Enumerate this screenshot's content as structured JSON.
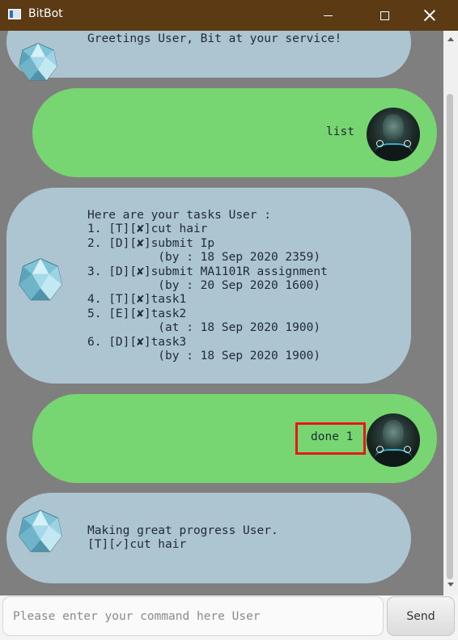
{
  "window": {
    "title": "BitBot"
  },
  "messages": [
    {
      "sender": "bot",
      "text": "Greetings User, Bit at your service!"
    },
    {
      "sender": "user",
      "text": "list"
    },
    {
      "sender": "bot",
      "text": "Here are your tasks User :\n1. [T][✘]cut hair\n2. [D][✘]submit Ip\n          (by : 18 Sep 2020 2359)\n3. [D][✘]submit MA1101R assignment\n          (by : 20 Sep 2020 1600)\n4. [T][✘]task1\n5. [E][✘]task2\n          (at : 18 Sep 2020 1900)\n6. [D][✘]task3\n          (by : 18 Sep 2020 1900)"
    },
    {
      "sender": "user",
      "text": "done 1",
      "highlighted": true
    },
    {
      "sender": "bot",
      "text": "Making great progress User.\n[T][✓]cut hair"
    }
  ],
  "input": {
    "placeholder": "Please enter your command here User",
    "value": ""
  },
  "send_button": {
    "label": "Send"
  },
  "colors": {
    "title_bar": "#5c3a13",
    "chat_background": "#7f7f7f",
    "bot_bubble": "#adc5d1",
    "user_bubble": "#77d671",
    "highlight": "#e8151c"
  },
  "icons": {
    "bot_avatar": "crystal-gem-icon",
    "user_avatar": "user-photo-avatar"
  }
}
